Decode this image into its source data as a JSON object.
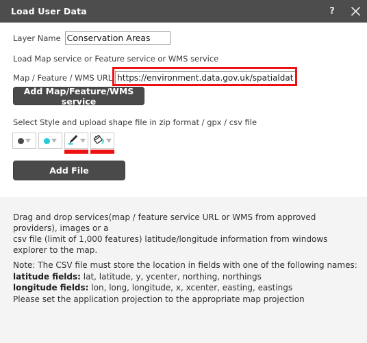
{
  "titlebar": {
    "title": "Load User Data",
    "help_label": "?",
    "help_icon": "question-mark-icon",
    "close_icon": "close-icon"
  },
  "form": {
    "layer_name_label": "Layer Name",
    "layer_name_value": "Conservation Areas",
    "layer_name_placeholder": "",
    "services_hint": "Load Map service or Feature service or WMS service",
    "url_label": "Map / Feature / WMS URL",
    "url_value": "https://environment.data.gov.uk/spatialdata/he-",
    "url_placeholder": "",
    "add_service_button": "Add Map/Feature/WMS service",
    "style_hint": "Select Style and upload shape file in zip format / gpx / csv file",
    "add_file_button": "Add File"
  },
  "style_pickers": [
    {
      "name": "point-symbol-picker",
      "icon": "filled-circle-icon",
      "swatch_color": "#4a4a4a",
      "highlighted": false
    },
    {
      "name": "point-color-picker",
      "icon": "filled-circle-icon",
      "swatch_color": "#22ccdd",
      "highlighted": false
    },
    {
      "name": "line-style-picker",
      "icon": "pen-marker-icon",
      "swatch_color": "#22ccdd",
      "highlighted": true
    },
    {
      "name": "fill-color-picker",
      "icon": "paint-bucket-icon",
      "swatch_color": "#22ccdd",
      "highlighted": true
    }
  ],
  "drag_drop_text": {
    "line1": "Drag and drop services(map / feature service URL or WMS from approved providers), images or a",
    "line2": "csv file (limit of 1,000 features) latitude/longitude information from windows explorer to the map."
  },
  "note": {
    "line1": "Note: The CSV file must store the location in fields with one of the following names:",
    "lat_label": "latitude fields:",
    "lat_values": " lat, latitude, y, ycenter, northing, northings",
    "lon_label": "longitude fields:",
    "lon_values": " lon, long, longitude, x, xcenter, easting, eastings",
    "line4": "Please set the application projection to the appropriate map projection"
  },
  "colors": {
    "titlebar_bg": "#4d4d4d",
    "button_bg": "#4a4a4a",
    "highlight_red": "#ee1111",
    "accent_cyan": "#22ccdd",
    "panel_gray": "#f4f4f4"
  }
}
